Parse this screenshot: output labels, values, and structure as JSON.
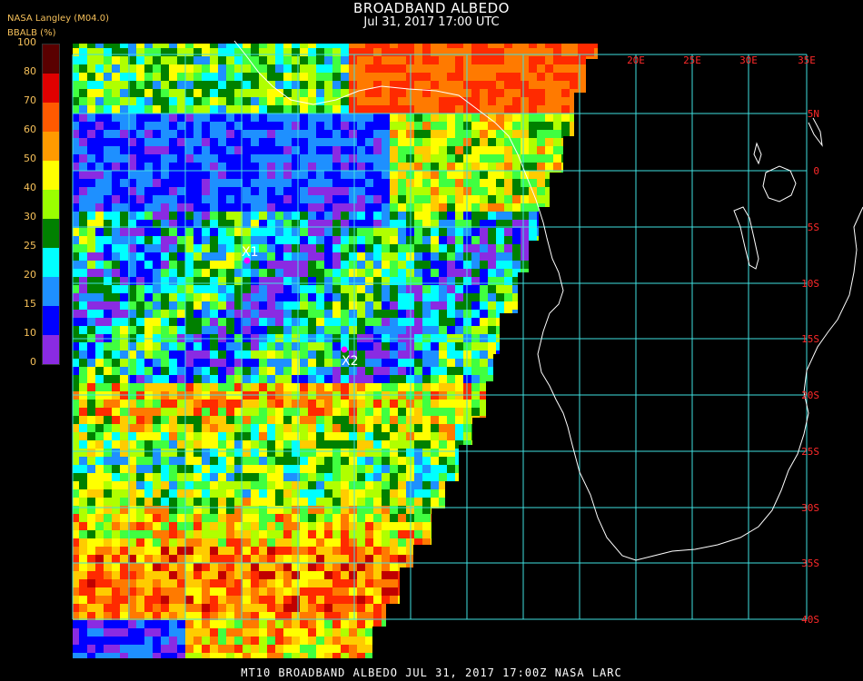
{
  "header": {
    "title": "BROADBAND ALBEDO",
    "subtitle": "Jul 31, 2017 17:00 UTC",
    "credit": "NASA Langley (M04.0)",
    "unit_label": "BBALB (%)"
  },
  "legend": {
    "ticks": [
      "100",
      "80",
      "70",
      "60",
      "50",
      "40",
      "30",
      "25",
      "20",
      "15",
      "10",
      "0"
    ],
    "colors": [
      "#5a0000",
      "#e00000",
      "#ff5a00",
      "#ff9a00",
      "#ffff00",
      "#9aff00",
      "#008000",
      "#00ffff",
      "#1e90ff",
      "#0000ff",
      "#8a2be2"
    ]
  },
  "map": {
    "longitude_labels": [
      "20E",
      "25E",
      "30E",
      "35E"
    ],
    "latitude_labels": [
      "5N",
      "0",
      "5S",
      "10S",
      "15S",
      "20S",
      "25S",
      "30S",
      "35S",
      "40S"
    ],
    "points": [
      {
        "label": "X1"
      },
      {
        "label": "X2"
      }
    ],
    "grid_color": "#40e0e0",
    "label_color": "#ff2a2a"
  },
  "footer": {
    "text": "MT10  BROADBAND ALBEDO   JUL 31, 2017 17:00Z   NASA LARC"
  }
}
